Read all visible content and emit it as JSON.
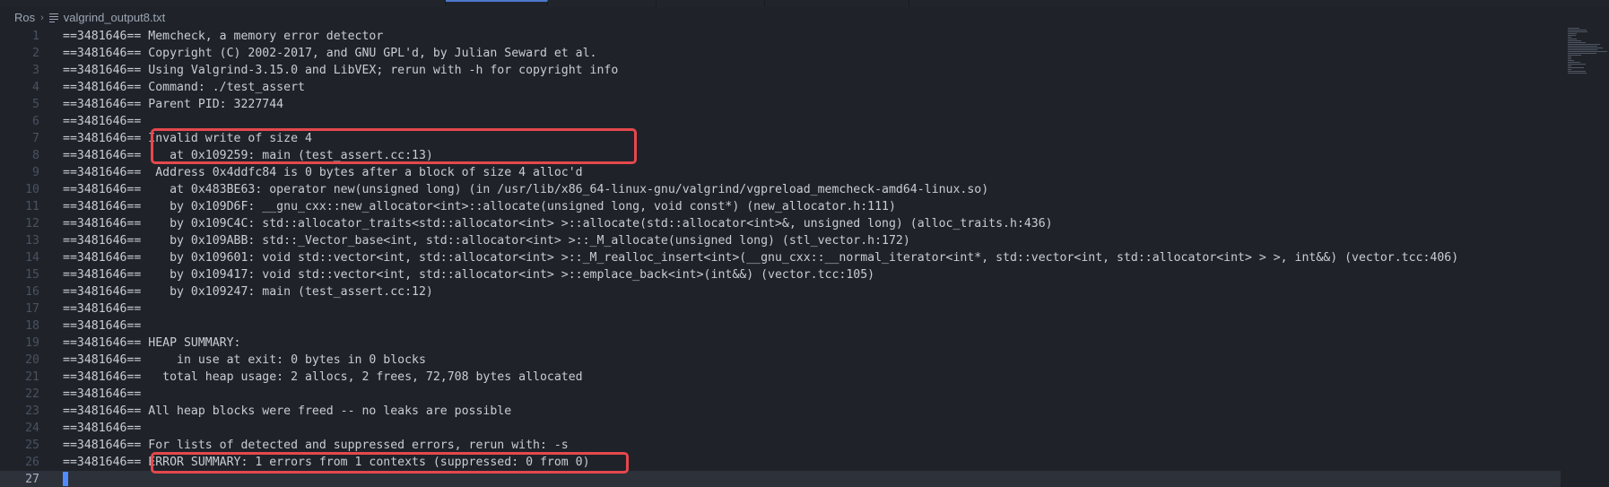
{
  "breadcrumb": {
    "folder": "Ros",
    "file": "valgrind_output8.txt"
  },
  "editor": {
    "lines": [
      {
        "n": "1",
        "text": "==3481646== Memcheck, a memory error detector"
      },
      {
        "n": "2",
        "text": "==3481646== Copyright (C) 2002-2017, and GNU GPL'd, by Julian Seward et al."
      },
      {
        "n": "3",
        "text": "==3481646== Using Valgrind-3.15.0 and LibVEX; rerun with -h for copyright info"
      },
      {
        "n": "4",
        "text": "==3481646== Command: ./test_assert"
      },
      {
        "n": "5",
        "text": "==3481646== Parent PID: 3227744"
      },
      {
        "n": "6",
        "text": "==3481646=="
      },
      {
        "n": "7",
        "text": "==3481646== Invalid write of size 4"
      },
      {
        "n": "8",
        "text": "==3481646==    at 0x109259: main (test_assert.cc:13)"
      },
      {
        "n": "9",
        "text": "==3481646==  Address 0x4ddfc84 is 0 bytes after a block of size 4 alloc'd"
      },
      {
        "n": "10",
        "text": "==3481646==    at 0x483BE63: operator new(unsigned long) (in /usr/lib/x86_64-linux-gnu/valgrind/vgpreload_memcheck-amd64-linux.so)"
      },
      {
        "n": "11",
        "text": "==3481646==    by 0x109D6F: __gnu_cxx::new_allocator<int>::allocate(unsigned long, void const*) (new_allocator.h:111)"
      },
      {
        "n": "12",
        "text": "==3481646==    by 0x109C4C: std::allocator_traits<std::allocator<int> >::allocate(std::allocator<int>&, unsigned long) (alloc_traits.h:436)"
      },
      {
        "n": "13",
        "text": "==3481646==    by 0x109ABB: std::_Vector_base<int, std::allocator<int> >::_M_allocate(unsigned long) (stl_vector.h:172)"
      },
      {
        "n": "14",
        "text": "==3481646==    by 0x109601: void std::vector<int, std::allocator<int> >::_M_realloc_insert<int>(__gnu_cxx::__normal_iterator<int*, std::vector<int, std::allocator<int> > >, int&&) (vector.tcc:406)"
      },
      {
        "n": "15",
        "text": "==3481646==    by 0x109417: void std::vector<int, std::allocator<int> >::emplace_back<int>(int&&) (vector.tcc:105)"
      },
      {
        "n": "16",
        "text": "==3481646==    by 0x109247: main (test_assert.cc:12)"
      },
      {
        "n": "17",
        "text": "==3481646=="
      },
      {
        "n": "18",
        "text": "==3481646=="
      },
      {
        "n": "19",
        "text": "==3481646== HEAP SUMMARY:"
      },
      {
        "n": "20",
        "text": "==3481646==     in use at exit: 0 bytes in 0 blocks"
      },
      {
        "n": "21",
        "text": "==3481646==   total heap usage: 2 allocs, 2 frees, 72,708 bytes allocated"
      },
      {
        "n": "22",
        "text": "==3481646=="
      },
      {
        "n": "23",
        "text": "==3481646== All heap blocks were freed -- no leaks are possible"
      },
      {
        "n": "24",
        "text": "==3481646=="
      },
      {
        "n": "25",
        "text": "==3481646== For lists of detected and suppressed errors, rerun with: -s"
      },
      {
        "n": "26",
        "text": "==3481646== ERROR SUMMARY: 1 errors from 1 contexts (suppressed: 0 from 0)"
      },
      {
        "n": "27",
        "text": ""
      }
    ],
    "current_line": "27"
  },
  "colors": {
    "background": "#1f2329",
    "highlight_border": "#e5484d",
    "cursor": "#528bff"
  }
}
